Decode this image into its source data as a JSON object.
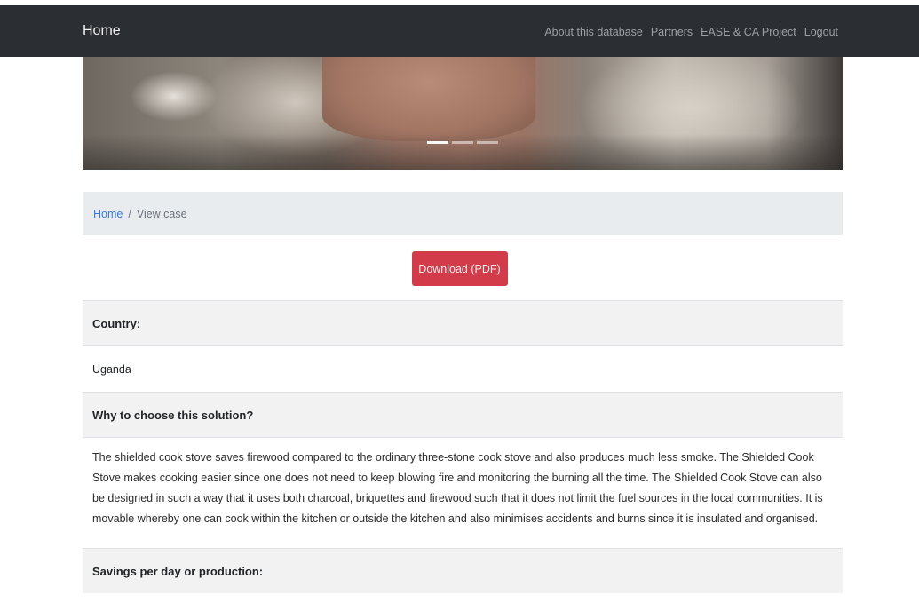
{
  "navbar": {
    "brand": "Home",
    "links": [
      "About this database",
      "Partners",
      "EASE & CA Project",
      "Logout"
    ]
  },
  "breadcrumb": {
    "home": "Home",
    "separator": "/",
    "current": "View case"
  },
  "download_button": "Download (PDF)",
  "details": {
    "country_label": "Country:",
    "country_value": "Uganda",
    "why_label": "Why to choose this solution?",
    "why_text": "The shielded cook stove saves firewood compared to the ordinary three-stone cook stove and also produces much less smoke. The Shielded Cook Stove makes cooking easier since one does not need to keep blowing fire and monitoring the burning all the time. The Shielded Cook Stove can also be designed in such a way that it uses both charcoal, briquettes and firewood such that it does not limit the fuel sources in the local communities. It is movable whereby one can cook within the kitchen or outside the kitchen and also minimises accidents and burns since it is insulated and organised.",
    "savings_label": "Savings per day or production:"
  },
  "colors": {
    "navbar_bg": "#2b2f33",
    "danger": "#d13b4a",
    "link": "#3a7bd5",
    "breadcrumb_bg": "#e9ecef"
  }
}
